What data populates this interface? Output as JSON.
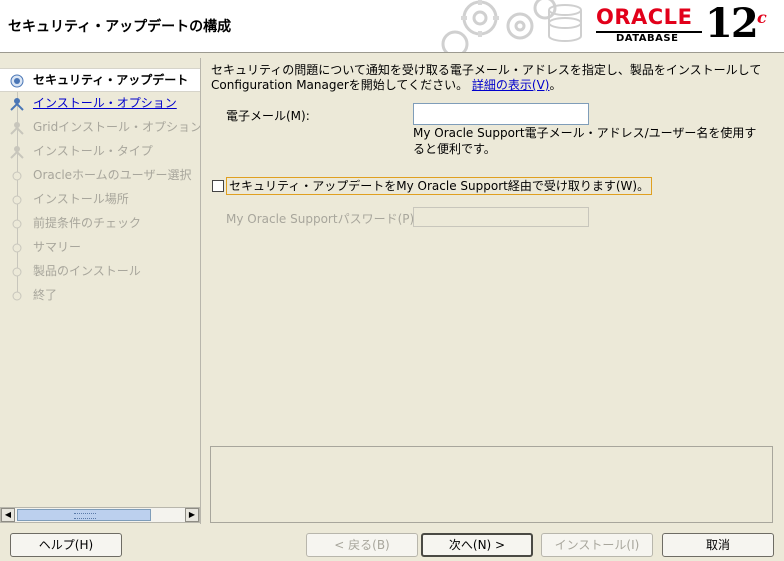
{
  "header": {
    "title": "セキュリティ・アップデートの構成",
    "logo": {
      "brand": "ORACLE",
      "product": "DATABASE",
      "version": "12",
      "version_suffix": "c"
    }
  },
  "nav": {
    "items": [
      {
        "label": "セキュリティ・アップデート",
        "state": "current",
        "icon": "current-step-icon"
      },
      {
        "label": "インストール・オプション",
        "state": "link",
        "icon": "person-step-icon"
      },
      {
        "label": "Gridインストール・オプション",
        "state": "disabled",
        "icon": "person-step-icon"
      },
      {
        "label": "インストール・タイプ",
        "state": "disabled",
        "icon": "person-step-icon"
      },
      {
        "label": "Oracleホームのユーザー選択",
        "state": "disabled",
        "icon": "dot-step-icon"
      },
      {
        "label": "インストール場所",
        "state": "disabled",
        "icon": "dot-step-icon"
      },
      {
        "label": "前提条件のチェック",
        "state": "disabled",
        "icon": "dot-step-icon"
      },
      {
        "label": "サマリー",
        "state": "disabled",
        "icon": "dot-step-icon"
      },
      {
        "label": "製品のインストール",
        "state": "disabled",
        "icon": "dot-step-icon"
      },
      {
        "label": "終了",
        "state": "disabled",
        "icon": "dot-step-icon"
      }
    ]
  },
  "main": {
    "intro_line1": "セキュリティの問題について通知を受け取る電子メール・アドレスを指定し、製品をインストールして",
    "intro_line2": "Configuration Managerを開始してください。",
    "details_link": "詳細の表示(V)",
    "intro_end": "。",
    "email_label": "電子メール(M):",
    "email_value": "",
    "email_hint": "My Oracle Support電子メール・アドレス/ユーザー名を使用すると便利です。",
    "security_checkbox_label": "セキュリティ・アップデートをMy Oracle Support経由で受け取ります(W)。",
    "security_checkbox_checked": false,
    "password_label": "My Oracle Supportパスワード(P):",
    "password_value": ""
  },
  "buttons": {
    "help": "ヘルプ(H)",
    "back": "< 戻る(B)",
    "next": "次へ(N) >",
    "install": "インストール(I)",
    "cancel": "取消"
  }
}
